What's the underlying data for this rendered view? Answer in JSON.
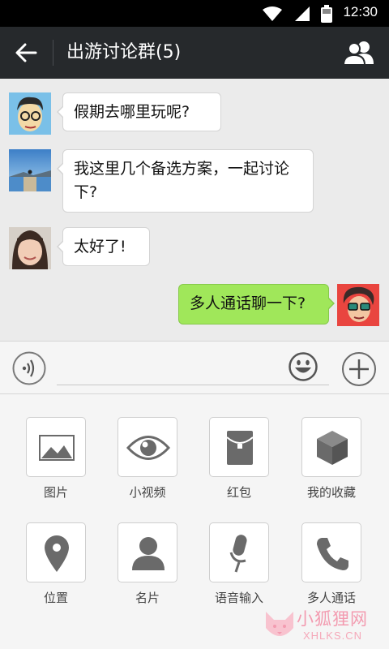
{
  "status_bar": {
    "time": "12:30"
  },
  "header": {
    "title": "出游讨论群(5)"
  },
  "messages": [
    {
      "side": "left",
      "text": "假期去哪里玩呢?"
    },
    {
      "side": "left",
      "text": "我这里几个备选方案，一起讨论下?"
    },
    {
      "side": "left",
      "text": "太好了!"
    },
    {
      "side": "right",
      "text": "多人通话聊一下?"
    }
  ],
  "input": {
    "value": ""
  },
  "tools": [
    {
      "label": "图片",
      "icon": "image-icon"
    },
    {
      "label": "小视频",
      "icon": "eye-icon"
    },
    {
      "label": "红包",
      "icon": "red-envelope-icon"
    },
    {
      "label": "我的收藏",
      "icon": "cube-icon"
    },
    {
      "label": "位置",
      "icon": "location-pin-icon"
    },
    {
      "label": "名片",
      "icon": "person-icon"
    },
    {
      "label": "语音输入",
      "icon": "microphone-icon"
    },
    {
      "label": "多人通话",
      "icon": "phone-icon"
    }
  ],
  "watermark": {
    "text": "小狐狸网",
    "sub": "XHLKS.CN"
  },
  "colors": {
    "title_bar": "#26292c",
    "my_bubble": "#a0e75a",
    "chat_bg": "#ebebeb",
    "watermark": "#f39bb0"
  }
}
